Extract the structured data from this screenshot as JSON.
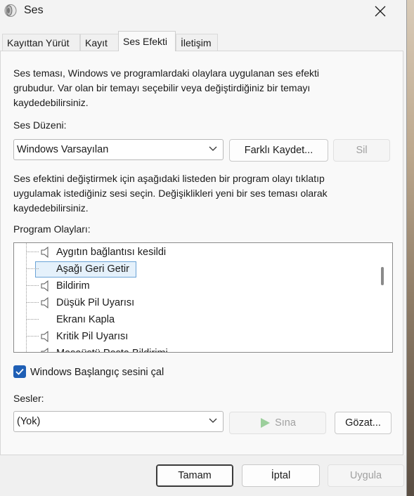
{
  "window": {
    "title": "Ses"
  },
  "tabs": [
    {
      "label": "Kayıttan Yürüt",
      "active": false
    },
    {
      "label": "Kayıt",
      "active": false
    },
    {
      "label": "Ses Efekti",
      "active": true
    },
    {
      "label": "İletişim",
      "active": false
    }
  ],
  "description": {
    "line1": "Ses teması, Windows ve programlardaki olaylara uygulanan ses efekti",
    "line2": "grubudur. Var olan bir temayı seçebilir veya değiştirdiğiniz bir temayı",
    "line3": "kaydedebilirsiniz."
  },
  "scheme": {
    "label": "Ses Düzeni:",
    "value": "Windows Varsayılan",
    "save_as_label": "Farklı Kaydet...",
    "delete_label": "Sil"
  },
  "instructions": {
    "line1": "Ses efektini değiştirmek için aşağıdaki listeden bir program olayı tıklatıp",
    "line2": "uygulamak istediğiniz sesi seçin. Değişiklikleri yeni bir ses teması olarak",
    "line3": "kaydedebilirsiniz."
  },
  "events": {
    "label": "Program Olayları:",
    "items": [
      {
        "label": "Aygıtın bağlantısı kesildi",
        "has_sound": true
      },
      {
        "label": "Aşağı Geri Getir",
        "has_sound": false,
        "selected": true
      },
      {
        "label": "Bildirim",
        "has_sound": true
      },
      {
        "label": "Düşük Pil Uyarısı",
        "has_sound": true
      },
      {
        "label": "Ekranı Kapla",
        "has_sound": false
      },
      {
        "label": "Kritik Pil Uyarısı",
        "has_sound": true
      },
      {
        "label": "Masaüstü Posta Bildirimi",
        "has_sound": true
      }
    ]
  },
  "startup": {
    "label": "Windows Başlangıç sesini çal",
    "checked": true
  },
  "sounds": {
    "label": "Sesler:",
    "value": "(Yok)",
    "test_label": "Sına",
    "browse_label": "Gözat..."
  },
  "footer": {
    "ok_label": "Tamam",
    "cancel_label": "İptal",
    "apply_label": "Uygula"
  },
  "colors": {
    "accent": "#1f5fb5",
    "selection": "#e5f1fb",
    "play_green": "#9ccf9c"
  }
}
